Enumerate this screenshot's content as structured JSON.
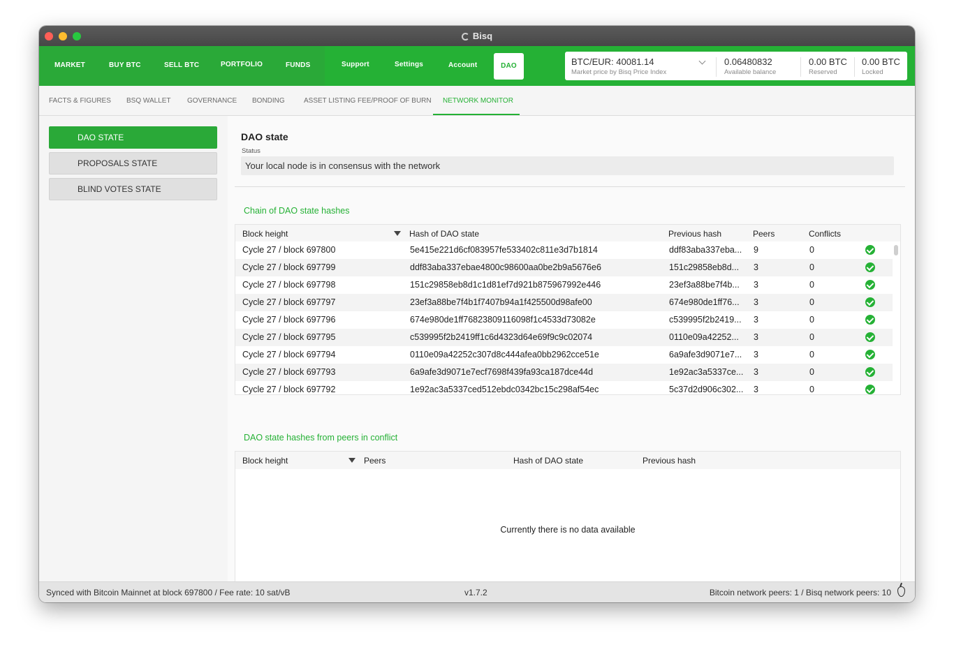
{
  "window": {
    "title": "Bisq"
  },
  "topnav": {
    "primary": [
      "MARKET",
      "BUY BTC",
      "SELL BTC",
      "PORTFOLIO",
      "FUNDS"
    ],
    "secondary": [
      "Support",
      "Settings",
      "Account",
      "DAO"
    ]
  },
  "pricebox": {
    "pair_price": "BTC/EUR: 40081.14",
    "pair_sub": "Market price by Bisq Price Index",
    "available": "0.06480832",
    "available_sub": "Available balance",
    "reserved": "0.00 BTC",
    "reserved_sub": "Reserved",
    "locked": "0.00 BTC",
    "locked_sub": "Locked"
  },
  "subnav": [
    "FACTS & FIGURES",
    "BSQ WALLET",
    "GOVERNANCE",
    "BONDING",
    "ASSET LISTING FEE/PROOF OF BURN",
    "NETWORK MONITOR"
  ],
  "sidebar": [
    "DAO STATE",
    "PROPOSALS STATE",
    "BLIND VOTES STATE"
  ],
  "main": {
    "title": "DAO state",
    "status_label": "Status",
    "status_value": "Your local node is in consensus with the network",
    "chain_title": "Chain of DAO state hashes",
    "chain_headers": [
      "Block height",
      "Hash of DAO state",
      "Previous hash",
      "Peers",
      "Conflicts"
    ],
    "chain_rows": [
      {
        "block": "Cycle 27 / block 697800",
        "hash": "5e415e221d6cf083957fe533402c811e3d7b1814",
        "prev": "ddf83aba337eba...",
        "peers": "9",
        "conflicts": "0"
      },
      {
        "block": "Cycle 27 / block 697799",
        "hash": "ddf83aba337ebae4800c98600aa0be2b9a5676e6",
        "prev": "151c29858eb8d...",
        "peers": "3",
        "conflicts": "0"
      },
      {
        "block": "Cycle 27 / block 697798",
        "hash": "151c29858eb8d1c1d81ef7d921b875967992e446",
        "prev": "23ef3a88be7f4b...",
        "peers": "3",
        "conflicts": "0"
      },
      {
        "block": "Cycle 27 / block 697797",
        "hash": "23ef3a88be7f4b1f7407b94a1f425500d98afe00",
        "prev": "674e980de1ff76...",
        "peers": "3",
        "conflicts": "0"
      },
      {
        "block": "Cycle 27 / block 697796",
        "hash": "674e980de1ff76823809116098f1c4533d73082e",
        "prev": "c539995f2b2419...",
        "peers": "3",
        "conflicts": "0"
      },
      {
        "block": "Cycle 27 / block 697795",
        "hash": "c539995f2b2419ff1c6d4323d64e69f9c9c02074",
        "prev": "0110e09a42252...",
        "peers": "3",
        "conflicts": "0"
      },
      {
        "block": "Cycle 27 / block 697794",
        "hash": "0110e09a42252c307d8c444afea0bb2962cce51e",
        "prev": "6a9afe3d9071e7...",
        "peers": "3",
        "conflicts": "0"
      },
      {
        "block": "Cycle 27 / block 697793",
        "hash": "6a9afe3d9071e7ecf7698f439fa93ca187dce44d",
        "prev": "1e92ac3a5337ce...",
        "peers": "3",
        "conflicts": "0"
      },
      {
        "block": "Cycle 27 / block 697792",
        "hash": "1e92ac3a5337ced512ebdc0342bc15c298af54ec",
        "prev": "5c37d2d906c302...",
        "peers": "3",
        "conflicts": "0"
      }
    ],
    "conflict_title": "DAO state hashes from peers in conflict",
    "conflict_headers": [
      "Block height",
      "Peers",
      "Hash of DAO state",
      "Previous hash"
    ],
    "conflict_empty": "Currently there is no data available"
  },
  "statusbar": {
    "left": "Synced with Bitcoin Mainnet at block 697800 / Fee rate: 10 sat/vB",
    "center": "v1.7.2",
    "right": "Bitcoin network peers: 1 / Bisq network peers: 10"
  },
  "colors": {
    "accent": "#25b135",
    "accent_dark": "#2aa938"
  }
}
